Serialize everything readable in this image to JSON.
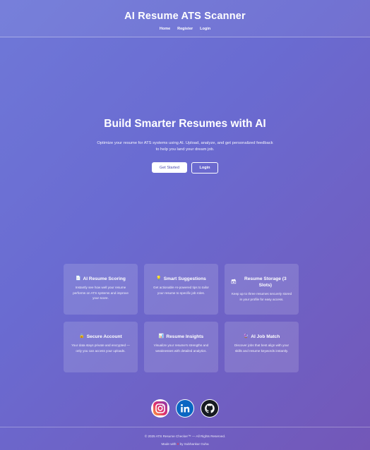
{
  "header": {
    "title": "AI Resume ATS Scanner",
    "nav": [
      "Home",
      "Register",
      "Login"
    ]
  },
  "hero": {
    "title": "Build Smarter Resumes with AI",
    "subtitle": "Optimize your resume for ATS systems using AI. Upload, analyze, and get personalized feedback to help you land your dream job.",
    "primary_button": "Get Started",
    "secondary_button": "Login"
  },
  "features": [
    {
      "icon": "📄",
      "icon_name": "document-icon",
      "title": "AI Resume Scoring",
      "desc": "Instantly see how well your resume performs on ATS systems and improve your score."
    },
    {
      "icon": "💡",
      "icon_name": "lightbulb-icon",
      "title": "Smart Suggestions",
      "desc": "Get actionable AI-powered tips to tailor your resume to specific job roles."
    },
    {
      "icon": "🗃",
      "icon_name": "storage-icon",
      "title": "Resume Storage (3 Slots)",
      "desc": "Keep up to three resumes securely stored in your profile for easy access."
    },
    {
      "icon": "🔒",
      "icon_name": "lock-icon",
      "title": "Secure Account",
      "desc": "Your data stays private and encrypted — only you can access your uploads."
    },
    {
      "icon": "📊",
      "icon_name": "bar-chart-icon",
      "title": "Resume Insights",
      "desc": "Visualize your resume's strengths and weaknesses with detailed analytics."
    },
    {
      "icon": "🔮",
      "icon_name": "crystal-ball-icon",
      "title": "AI Job Match",
      "desc": "Discover jobs that best align with your skills and resume keywords instantly."
    }
  ],
  "socials": [
    "instagram-icon",
    "linkedin-icon",
    "github-icon"
  ],
  "footer": {
    "copyright": "© 2025 ATS Resume Checker™ — All Rights Reserved.",
    "made_with": "Made with",
    "heart": "♥",
    "by": "by Subhankar Guha"
  },
  "colors": {
    "background_start": "#6f78d8",
    "background_end": "#7357b8",
    "primary_button_text": "#4b4bb0",
    "heart": "#e53950"
  }
}
